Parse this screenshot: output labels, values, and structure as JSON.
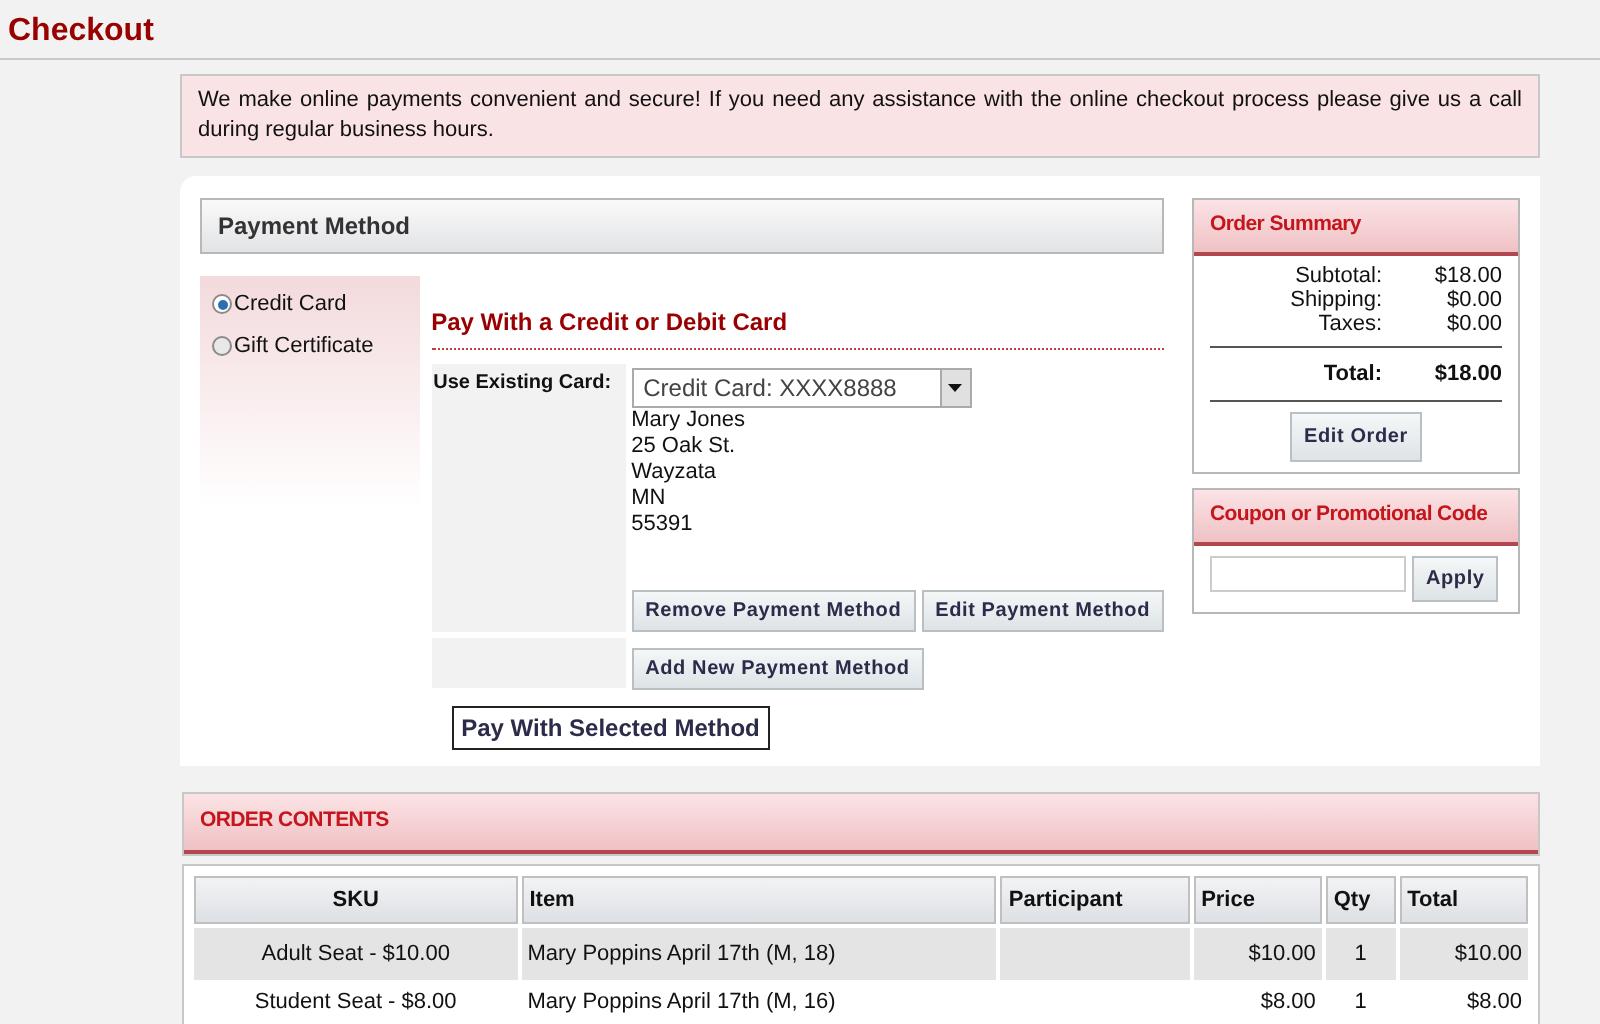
{
  "page_title": "Checkout",
  "notice": "We make online payments convenient and secure! If you need any assistance with the online checkout process please give us a call during regular business hours.",
  "payment_method": {
    "title": "Payment Method",
    "options": [
      {
        "label": "Credit Card",
        "selected": true
      },
      {
        "label": "Gift Certificate",
        "selected": false
      }
    ],
    "heading": "Pay With a Credit or Debit Card",
    "existing_card_label": "Use Existing Card:",
    "existing_card_value": "Credit Card: XXXX8888",
    "address": [
      "Mary Jones",
      "25 Oak St.",
      "Wayzata",
      "MN",
      "55391"
    ],
    "card_buttons": [
      "Remove Payment Method",
      "Edit Payment Method"
    ],
    "add_button": "Add New Payment Method",
    "pay_button": "Pay With Selected Method"
  },
  "order_summary": {
    "title": "Order Summary",
    "lines": [
      {
        "label": "Subtotal:",
        "value": "$18.00"
      },
      {
        "label": "Shipping:",
        "value": "$0.00"
      },
      {
        "label": "Taxes:",
        "value": "$0.00"
      }
    ],
    "total": {
      "label": "Total:",
      "value": "$18.00"
    },
    "edit_button": "Edit Order"
  },
  "coupon": {
    "title": "Coupon or Promotional Code",
    "button": "Apply"
  },
  "order_contents": {
    "title": "ORDER CONTENTS",
    "columns": [
      "SKU",
      "Item",
      "Participant",
      "Price",
      "Qty",
      "Total"
    ],
    "rows": [
      {
        "sku": "Adult Seat - $10.00",
        "item": "Mary Poppins April 17th (M, 18)",
        "price": "$10.00",
        "qty": "1",
        "total": "$10.00"
      },
      {
        "sku": "Student Seat - $8.00",
        "item": "Mary Poppins April 17th (M, 16)",
        "price": "$8.00",
        "qty": "1",
        "total": "$8.00"
      }
    ]
  }
}
